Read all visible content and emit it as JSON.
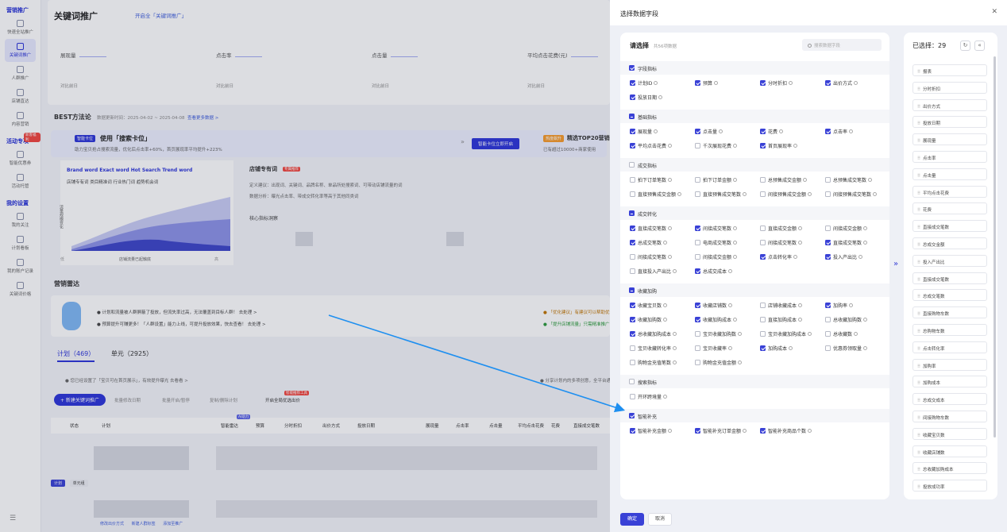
{
  "sidebar": {
    "group1": "营销推广",
    "items": [
      {
        "label": "快速全站推广"
      },
      {
        "label": "关键词推广",
        "active": true
      },
      {
        "label": "人群推广"
      },
      {
        "label": "店铺直达"
      },
      {
        "label": "内容营销"
      }
    ],
    "group2": "活动专项",
    "items2": [
      {
        "label": "智能优惠券"
      },
      {
        "label": "活动托管"
      }
    ],
    "badge": "新客福利",
    "group3": "我的设置",
    "items3": [
      {
        "label": "我的关注"
      },
      {
        "label": "计划看板"
      },
      {
        "label": "我的账户记录"
      },
      {
        "label": "关键词价格"
      }
    ]
  },
  "page": {
    "title": "关键词推广",
    "subtitle": "开启全「关键词推广」",
    "metrics": [
      {
        "label": "展现量"
      },
      {
        "label": "点击率"
      },
      {
        "label": "点击量"
      },
      {
        "label": "平均点击花费(元)"
      }
    ],
    "compare": "对比前日",
    "best_title": "BEST方法论",
    "best_date": "数据更新时间：2025-04-02 ~ 2025-04-08",
    "best_link": "查看更多数据 >",
    "banner_tag": "智能卡位",
    "banner_title": "使用「搜索卡位」",
    "banner_desc": "助力宝贝抢占搜索流量，优化后点击率+60%，首页展现率平均提升+223%",
    "banner_btn": "智能卡位立即开启",
    "hot_tag": "热度飙升",
    "hot_title": "精选TOP20营销创意",
    "hot_desc": "已有超过10000+商家使用",
    "brand_row": "Brand word   Exact word   Hot Search   Trend word",
    "radio_row": "店铺专有词    类目精准词    行业热门词    趋势机会词",
    "chart_ylabel": "流量规模变化",
    "chart_xlabel": "店铺流量已起触底",
    "ax_lo": "低",
    "ax_hi": "高",
    "store_title": "店铺专有词",
    "store_tag": "专属推荐",
    "store_l1": "定义建议：出现词、关键词、品牌名称、单品所处搜索词、可带动店铺流量的词",
    "store_l2": "数据分析：曝光点击率、带成交转化率等高于其他同类词",
    "core_title": "核心指标洞察",
    "radar_title": "营销雷达",
    "radar_l1": "● 计划和流量被人群屏蔽了投放，但流失率过高，无法覆盖到目标人群！ 去处理 >",
    "radar_l2": "● 预算提升可赚更多！「人群设置」能力上线，可提升投放效果，快去查看！ 去处理 >",
    "radar_r1": "● 「优化建议」有建议可以帮助优化",
    "radar_r2": "● 「提升店铺流量」只需精准推广",
    "tabs": [
      "计划（469）",
      "单元（2925）"
    ],
    "notice": "● 您已经设置了「宝贝可在首页展示」，有效提升曝光  去看看 >",
    "notice2": "● 分享计划内的多项创意，全平台通用",
    "new_btn": "+ 新建关键词推广",
    "toolbar": [
      "批量修改日期",
      "批量开启/暂停",
      "复制/删除计划",
      "开启全局优选出价"
    ],
    "toolbar_tag": "智能推荐工具",
    "table_headers": [
      "状态",
      "计划",
      "智能雷达",
      "预算",
      "分时折扣",
      "出价方式",
      "投放日期",
      "展现量",
      "点击率",
      "点击量",
      "平均点击花费",
      "花费",
      "直接成交笔数"
    ],
    "ai_tag": "AI助力",
    "switch_labels": [
      "计划",
      "单元组"
    ],
    "foot_links": [
      "修改出价方式",
      "新建人群标签",
      "添加至推广"
    ]
  },
  "drawer": {
    "title": "选择数据字段",
    "left_title": "请选择",
    "left_count": "共56项数据",
    "search_placeholder": "搜索数据字段",
    "groups": [
      {
        "name": "字段指标",
        "state": "on",
        "fields": [
          {
            "label": "计划ID",
            "checked": true
          },
          {
            "label": "预算",
            "checked": true
          },
          {
            "label": "分时折扣",
            "checked": true
          },
          {
            "label": "出价方式",
            "checked": true
          },
          {
            "label": "投放日期",
            "checked": true
          }
        ]
      },
      {
        "name": "基础指标",
        "state": "half",
        "fields": [
          {
            "label": "展现量",
            "checked": true
          },
          {
            "label": "点击量",
            "checked": true
          },
          {
            "label": "花费",
            "checked": true
          },
          {
            "label": "点击率",
            "checked": true
          },
          {
            "label": "平均点击花费",
            "checked": true
          },
          {
            "label": "千次展现花费",
            "checked": false
          },
          {
            "label": "首页展现率",
            "checked": true
          }
        ]
      },
      {
        "name": "成交指标",
        "state": "off",
        "fields": [
          {
            "label": "拍下订单笔数",
            "checked": false
          },
          {
            "label": "拍下订单金额",
            "checked": false
          },
          {
            "label": "总预售成交金额",
            "checked": false
          },
          {
            "label": "总预售成交笔数",
            "checked": false
          },
          {
            "label": "直接预售成交金额",
            "checked": false
          },
          {
            "label": "直接预售成交笔数",
            "checked": false
          },
          {
            "label": "间接预售成交金额",
            "checked": false
          },
          {
            "label": "间接预售成交笔数",
            "checked": false
          }
        ]
      },
      {
        "name": "成交转化",
        "state": "half",
        "fields": [
          {
            "label": "直接成交笔数",
            "checked": true
          },
          {
            "label": "间接成交笔数",
            "checked": true
          },
          {
            "label": "直接成交金额",
            "checked": false
          },
          {
            "label": "间接成交金额",
            "checked": false
          },
          {
            "label": "总成交笔数",
            "checked": true
          },
          {
            "label": "电商成交笔数",
            "checked": false
          },
          {
            "label": "间接成交笔数",
            "checked": false
          },
          {
            "label": "直接成交笔数",
            "checked": true
          },
          {
            "label": "间接成交笔数",
            "checked": false
          },
          {
            "label": "间接成交金额",
            "checked": false
          },
          {
            "label": "点击转化率",
            "checked": true
          },
          {
            "label": "投入产出比",
            "checked": true
          },
          {
            "label": "直接投入产出比",
            "checked": false
          },
          {
            "label": "总成交成本",
            "checked": true
          }
        ]
      },
      {
        "name": "收藏加购",
        "state": "half",
        "fields": [
          {
            "label": "收藏宝贝数",
            "checked": true
          },
          {
            "label": "收藏店铺数",
            "checked": true
          },
          {
            "label": "店铺收藏成本",
            "checked": false
          },
          {
            "label": "加购率",
            "checked": true
          },
          {
            "label": "收藏加购数",
            "checked": true
          },
          {
            "label": "收藏加购成本",
            "checked": true
          },
          {
            "label": "直接加购成本",
            "checked": false
          },
          {
            "label": "总收藏加购数",
            "checked": false
          },
          {
            "label": "总收藏加购成本",
            "checked": true
          },
          {
            "label": "宝贝收藏加购数",
            "checked": false
          },
          {
            "label": "宝贝收藏加购成本",
            "checked": false
          },
          {
            "label": "总收藏数",
            "checked": false
          },
          {
            "label": "宝贝收藏转化率",
            "checked": false
          },
          {
            "label": "宝贝收藏率",
            "checked": false
          },
          {
            "label": "加购成本",
            "checked": true
          },
          {
            "label": "优惠券领取量",
            "checked": false
          },
          {
            "label": "购物金充值笔数",
            "checked": false
          },
          {
            "label": "购物金充值金额",
            "checked": false
          }
        ]
      },
      {
        "name": "搜索指标",
        "state": "off",
        "fields": [
          {
            "label": "开环跨境量",
            "checked": false
          }
        ]
      },
      {
        "name": "智能补充",
        "state": "on",
        "fields": [
          {
            "label": "智能补充金额",
            "checked": true
          },
          {
            "label": "智能补充订单金额",
            "checked": true
          },
          {
            "label": "智能补充商品个数",
            "checked": true
          }
        ]
      }
    ],
    "right_title": "已选择：29",
    "selected": [
      "报表",
      "分时折扣",
      "出价方式",
      "投放日期",
      "展现量",
      "点击率",
      "点击量",
      "平均点击花费",
      "花费",
      "直接成交笔数",
      "总成交金额",
      "投入产出比",
      "直接成交笔数",
      "总成交笔数",
      "直接购物车数",
      "总购物车数",
      "点击转化率",
      "加购率",
      "加购成本",
      "总成交成本",
      "间接购物车数",
      "收藏宝贝数",
      "收藏店铺数",
      "总收藏加购成本",
      "投放成功率"
    ],
    "ok": "确定",
    "cancel": "取消"
  }
}
